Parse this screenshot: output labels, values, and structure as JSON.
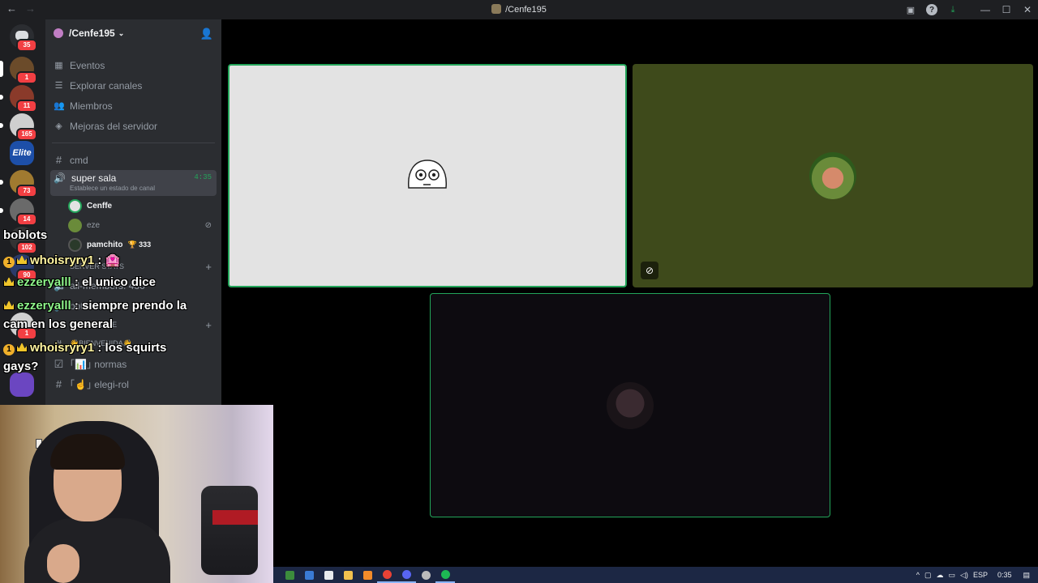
{
  "titlebar": {
    "back": "←",
    "forward": "→",
    "title": "/Cenfe195"
  },
  "rail": {
    "servers": [
      {
        "badge": "35",
        "color": "#5865f2"
      },
      {
        "badge": "1",
        "color": "#6b4b2a"
      },
      {
        "badge": "11",
        "color": "#8a3a2a"
      },
      {
        "badge": "165",
        "color": "#cfcfcf"
      },
      {
        "label": "Elite",
        "color": "#1d4fa8"
      },
      {
        "badge": "73",
        "color": "#a07a30"
      },
      {
        "badge": "14",
        "color": "#6a6a6a"
      },
      {
        "badge": "102",
        "color": "#333"
      },
      {
        "badge": "90",
        "color": "#2a3a6a"
      },
      {
        "badge": "1",
        "color": "#d0d0d0"
      },
      {
        "badge": "",
        "color": "#6b46c1"
      }
    ]
  },
  "sidebar": {
    "server_name": "/Cenfe195",
    "nav": [
      {
        "label": "Eventos",
        "icon": "calendar-icon"
      },
      {
        "label": "Explorar canales",
        "icon": "list-icon"
      },
      {
        "label": "Miembros",
        "icon": "members-icon"
      },
      {
        "label": "Mejoras del servidor",
        "icon": "boost-icon"
      }
    ],
    "channels": {
      "cmd": "cmd",
      "voice": {
        "name": "super sala",
        "timer": "4:35",
        "status": "Establece un estado de canal"
      },
      "voice_users": [
        {
          "name": "Cenffe",
          "color": "#e3e3e3"
        },
        {
          "name": "eze",
          "color": "#6a8b3a"
        },
        {
          "name": "pamchito",
          "extra": "🏆 333",
          "color": "#2a3a2a"
        }
      ],
      "server_stats_category": "SERVER STATS",
      "all_members": "all-members: 436",
      "bots": "bots- 14",
      "important_category": "IMPORTANTE",
      "bienvenida": "👋BIENVENIDA👋",
      "normas": "｢📊｣ normas",
      "elegi_rol": "｢☝｣ elegi-rol"
    }
  },
  "overlay_chat": {
    "line1": "boblots",
    "msg1_user": "whoisryry1",
    "msg1_text": " : 🏩",
    "msg2_user": "ezzeryalll",
    "msg2_text": " : el unico dice",
    "msg3_user": "ezzeryalll",
    "msg3_text": " : siempre prendo la",
    "msg3_cont": "cam en los general",
    "msg4_user": "whoisryry1",
    "msg4_text": " : los squirts",
    "msg4_cont": "gays?",
    "num": "1"
  },
  "taskbar": {
    "apps": [
      {
        "name": "app-icon",
        "color": "#3c8c3c"
      },
      {
        "name": "edit-icon",
        "color": "#3a7bd5"
      },
      {
        "name": "terminal-icon",
        "color": "#e8eaed"
      },
      {
        "name": "folder-icon",
        "color": "#f2c14e"
      },
      {
        "name": "app2-icon",
        "color": "#f28b2a"
      },
      {
        "name": "chrome-icon",
        "color": "#e94235"
      },
      {
        "name": "discord-icon",
        "color": "#5865f2"
      },
      {
        "name": "obs-icon",
        "color": "#bbbbbb"
      },
      {
        "name": "spotify-icon",
        "color": "#1db954"
      }
    ],
    "lang": "ESP",
    "time": "0:35"
  }
}
